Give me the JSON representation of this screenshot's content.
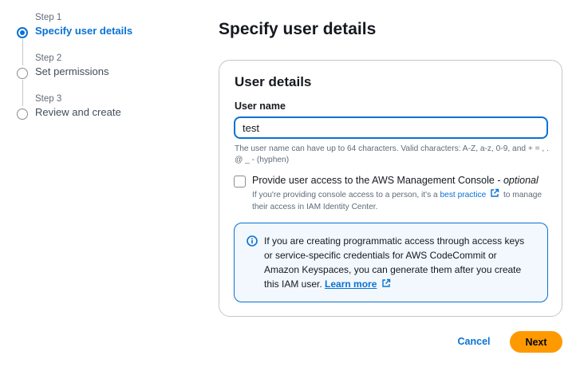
{
  "wizard": {
    "steps": [
      {
        "number": "Step 1",
        "title": "Specify user details",
        "active": true
      },
      {
        "number": "Step 2",
        "title": "Set permissions",
        "active": false
      },
      {
        "number": "Step 3",
        "title": "Review and create",
        "active": false
      }
    ]
  },
  "page": {
    "title": "Specify user details"
  },
  "user_details": {
    "heading": "User details",
    "username_label": "User name",
    "username_value": "test",
    "username_hint": "The user name can have up to 64 characters. Valid characters: A-Z, a-z, 0-9, and + = , . @ _ - (hyphen)",
    "console_access": {
      "checked": false,
      "label": "Provide user access to the AWS Management Console - ",
      "optional": "optional",
      "desc_before": "If you're providing console access to a person, it's a ",
      "desc_link": "best practice",
      "desc_after": " to manage their access in IAM Identity Center."
    },
    "info": {
      "text": "If you are creating programmatic access through access keys or service-specific credentials for AWS CodeCommit or Amazon Keyspaces, you can generate them after you create this IAM user. ",
      "link": "Learn more"
    }
  },
  "footer": {
    "cancel_label": "Cancel",
    "next_label": "Next"
  },
  "colors": {
    "accent": "#0972d3",
    "primary_button": "#ff9900",
    "info_bg": "#f2f8fd"
  },
  "icons": [
    "step-dot-icon",
    "external-link-icon",
    "info-icon",
    "checkbox"
  ]
}
